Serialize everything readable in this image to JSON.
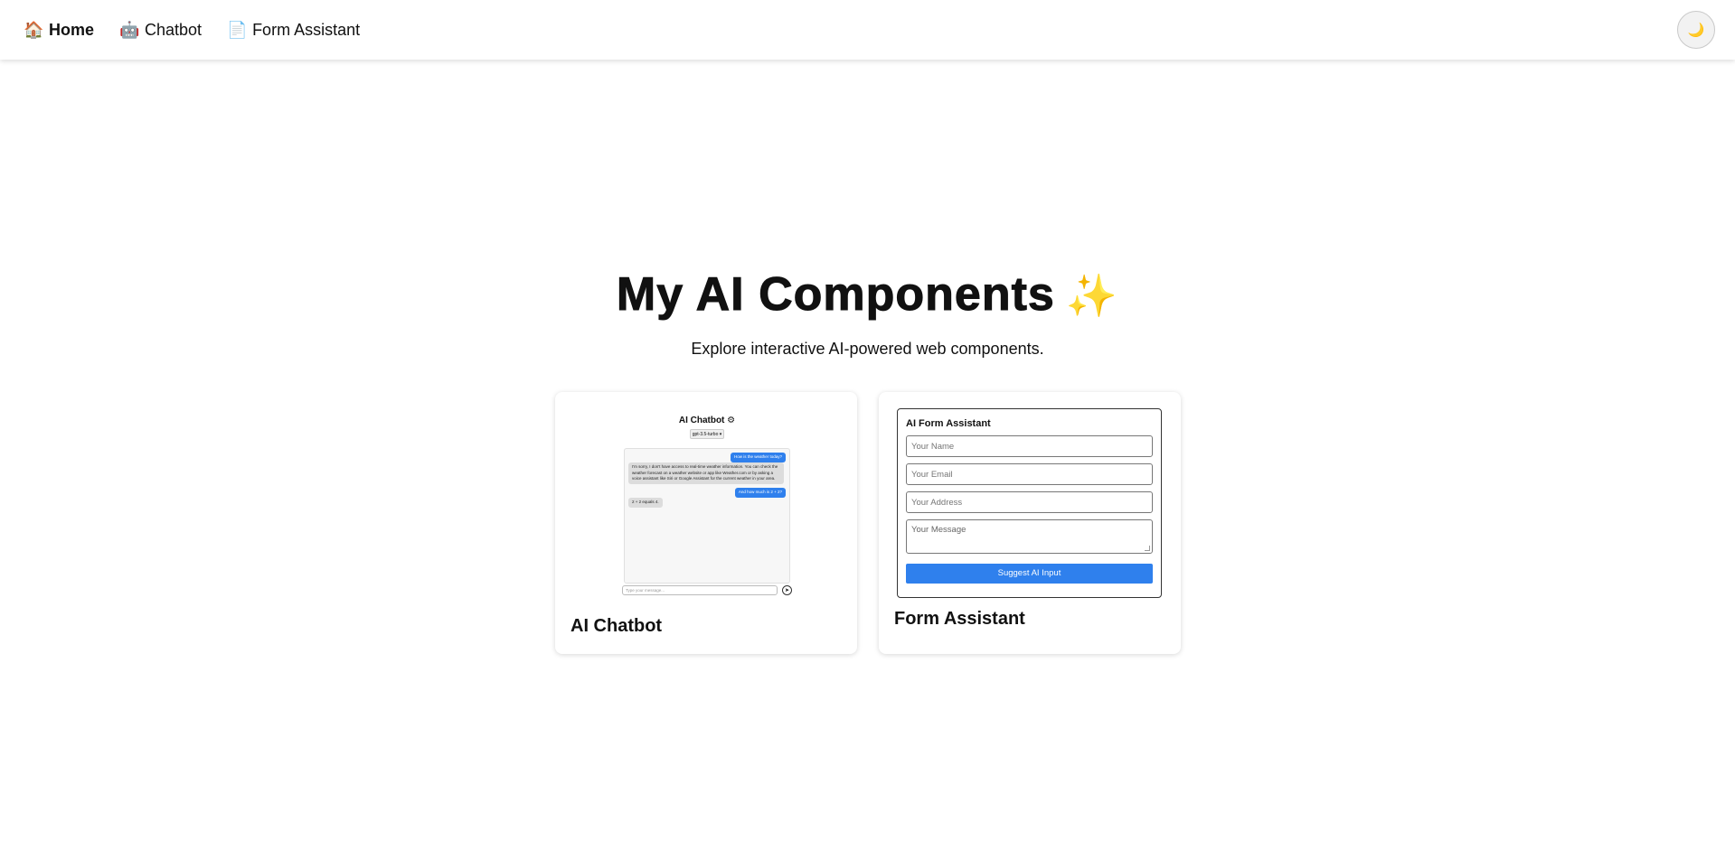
{
  "nav": {
    "items": [
      {
        "icon": "house-icon",
        "glyph": "🏠",
        "label": "Home",
        "active": true
      },
      {
        "icon": "robot-icon",
        "glyph": "🤖",
        "label": "Chatbot",
        "active": false
      },
      {
        "icon": "document-icon",
        "glyph": "📄",
        "label": "Form Assistant",
        "active": false
      }
    ],
    "theme_toggle_glyph": "🌙"
  },
  "hero": {
    "title": "My AI Components",
    "title_glyph": "✨",
    "subtitle": "Explore interactive AI-powered web components."
  },
  "cards": {
    "chatbot": {
      "title": "AI Chatbot",
      "preview": {
        "header": "AI Chatbot",
        "header_glyph": "⚙",
        "model": "gpt-3.5-turbo ▾",
        "messages": [
          {
            "role": "user",
            "text": "How is the weather today?"
          },
          {
            "role": "bot",
            "text": "I'm sorry, I don't have access to real-time weather information. You can check the weather forecast on a weather website or app like Weather.com or by asking a voice assistant like Siri or Google Assistant for the current weather in your area."
          },
          {
            "role": "user",
            "text": "And how much is 2 + 2?"
          },
          {
            "role": "bot",
            "text": "2 + 2 equals 4."
          }
        ],
        "input_placeholder": "Type your message...",
        "send_glyph": "➤"
      }
    },
    "form": {
      "title": "Form Assistant",
      "preview": {
        "heading": "AI Form Assistant",
        "name_placeholder": "Your Name",
        "email_placeholder": "Your Email",
        "address_placeholder": "Your Address",
        "message_placeholder": "Your Message",
        "button_label": "Suggest AI Input"
      }
    }
  },
  "colors": {
    "accent": "#2f80ed",
    "sparkle": "#f4b73a"
  }
}
